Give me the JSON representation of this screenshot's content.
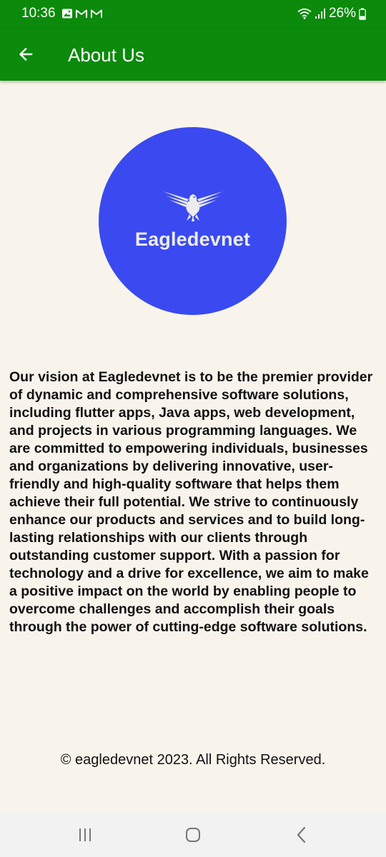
{
  "status_bar": {
    "time": "10:36",
    "left_icons": [
      "gallery-icon",
      "gmail-icon",
      "gmail-icon"
    ],
    "battery_percent": "26%",
    "right_icons": [
      "wifi-icon",
      "signal-icon",
      "battery-icon"
    ]
  },
  "app_bar": {
    "title": "About Us",
    "back_icon": "arrow-back-icon",
    "background_color": "#0b8a0b"
  },
  "logo": {
    "text": "Eagledevnet",
    "circle_color": "#3a4af0"
  },
  "content": {
    "vision_text": "Our vision at Eagledevnet is to be the premier provider of dynamic and comprehensive software solutions, including flutter apps, Java apps, web development, and projects in various programming languages. We are committed to empowering individuals, businesses and organizations by delivering innovative, user-friendly and high-quality software that helps them achieve their full potential. We strive to continuously enhance our products and services and to build long-lasting relationships with our clients through outstanding customer support. With a passion for technology and a drive for excellence, we aim to make a positive impact on the world by enabling people to overcome challenges and accomplish their goals through the power of cutting-edge software solutions."
  },
  "footer": {
    "copyright": "© eagledevnet 2023. All Rights Reserved."
  },
  "nav_bar": {
    "items": [
      "recents-icon",
      "home-icon",
      "back-icon"
    ]
  }
}
